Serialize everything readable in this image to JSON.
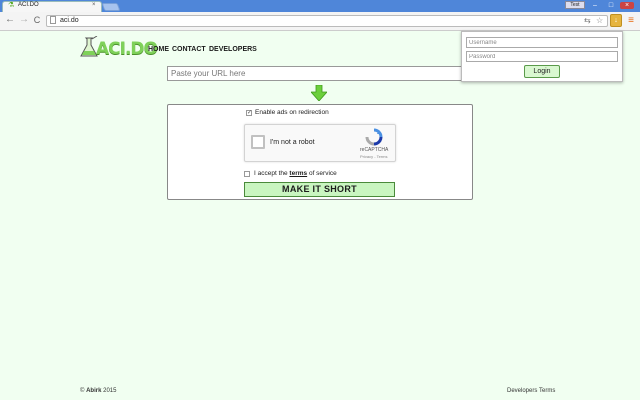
{
  "browser": {
    "tab_title": "ACI.DO",
    "tab_close": "×",
    "user_label": "Test",
    "window_minimize": "–",
    "window_maximize": "□",
    "window_close": "×",
    "nav_back": "←",
    "nav_forward": "→",
    "nav_reload": "C",
    "url": "aci.do",
    "ext_icon": "↓",
    "menu_icon": "≡"
  },
  "site": {
    "logo_text": "ACI.DO",
    "nav": [
      "HOME",
      "CONTACT",
      "DEVELOPERS"
    ],
    "url_placeholder": "Paste your URL here",
    "enable_ads_label": "Enable ads on redirection",
    "enable_ads_checked": true,
    "recaptcha": {
      "label": "I'm not a robot",
      "brand": "reCAPTCHA",
      "links": "Privacy - Terms"
    },
    "terms_prefix": "I accept the",
    "terms_link": "terms",
    "terms_suffix": "of service",
    "terms_checked": false,
    "submit_label": "MAKE IT SHORT"
  },
  "login": {
    "username_placeholder": "Username",
    "password_placeholder": "Password",
    "button_label": "Login"
  },
  "footer": {
    "copyright_symbol": "©",
    "owner": "Abirk",
    "year": "2015",
    "links": [
      "Developers",
      "Terms"
    ]
  },
  "colors": {
    "page_background": "#f1fff1",
    "accent_green": "#7fd15a",
    "button_green": "#c9f5c0",
    "titlebar_blue": "#4f86d9"
  }
}
